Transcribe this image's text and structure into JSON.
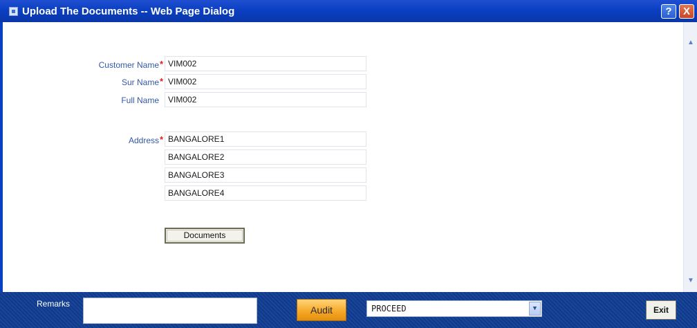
{
  "window": {
    "title": "Upload The Documents -- Web Page Dialog",
    "help_label": "?",
    "close_label": "X"
  },
  "form": {
    "customer_name": {
      "label": "Customer Name",
      "value": "VIM002"
    },
    "sur_name": {
      "label": "Sur Name",
      "value": "VIM002"
    },
    "full_name": {
      "label": "Full Name",
      "value": "VIM002"
    },
    "address": {
      "label": "Address",
      "lines": [
        "BANGALORE1",
        "BANGALORE2",
        "BANGALORE3",
        "BANGALORE4"
      ]
    },
    "required_marker": "*",
    "documents_button": "Documents"
  },
  "scrollbar": {
    "up_icon": "▲",
    "down_icon": "▼"
  },
  "footer": {
    "remarks_label": "Remarks",
    "remarks_value": "",
    "audit_button": "Audit",
    "action_select": {
      "selected": "PROCEED",
      "arrow": "▼"
    },
    "exit_button": "Exit"
  }
}
